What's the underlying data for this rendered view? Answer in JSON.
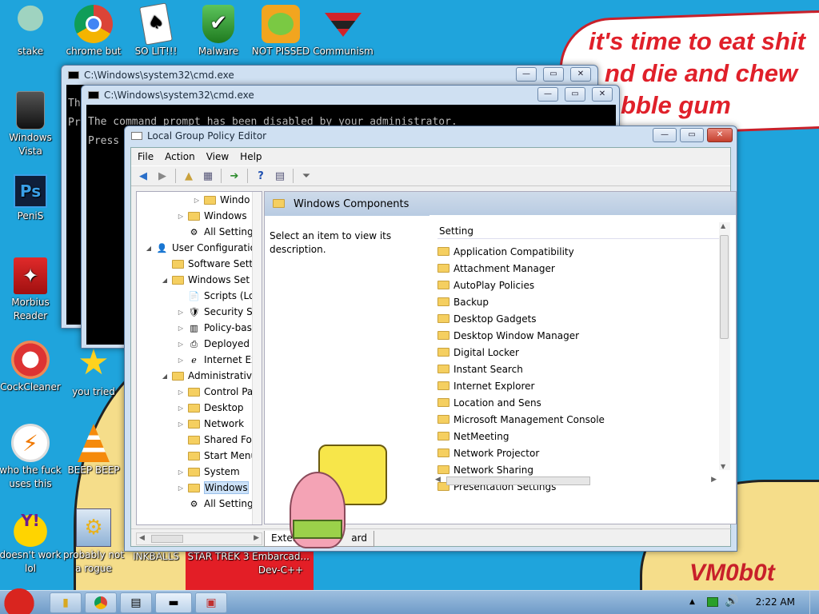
{
  "wallpaper": {
    "speech_lines": [
      "it's time to eat shit",
      "nd die and chew",
      "bble gum"
    ],
    "signature": "VM0b0t"
  },
  "desktop_icons": [
    {
      "label": "stake",
      "icon": "squidward-icon"
    },
    {
      "label": "chrome but",
      "icon": "chrome-icon"
    },
    {
      "label": "SO LIT!!!",
      "icon": "card-icon"
    },
    {
      "label": "Malware",
      "icon": "shield-check-icon"
    },
    {
      "label": "NOT PISSED",
      "icon": "angry-birds-pig-icon"
    },
    {
      "label": "Communism",
      "icon": "emblem-icon"
    },
    {
      "label": "Windows Vista",
      "icon": "recycle-bin-icon"
    },
    {
      "label": "PeniS",
      "icon": "photoshop-icon"
    },
    {
      "label": "Morbius Reader",
      "icon": "acrobat-icon"
    },
    {
      "label": "CockCleaner",
      "icon": "ccleaner-icon"
    },
    {
      "label": "you tried",
      "icon": "star-icon"
    },
    {
      "label": "who the fuck uses this",
      "icon": "winamp-icon"
    },
    {
      "label": "BEEP BEEP",
      "icon": "vlc-cone-icon"
    },
    {
      "label": "doesn't work lol",
      "icon": "yahoo-messenger-icon"
    },
    {
      "label": "probably not a rogue",
      "icon": "gears-icon"
    },
    {
      "label": "INKBALLS",
      "icon": ""
    },
    {
      "label": "STAR TREK 3",
      "icon": ""
    },
    {
      "label": "Embarcad... Dev-C++",
      "icon": ""
    }
  ],
  "cmd_back": {
    "title": "C:\\Windows\\system32\\cmd.exe",
    "lines": [
      "Th",
      "Pr"
    ]
  },
  "cmd_front": {
    "title": "C:\\Windows\\system32\\cmd.exe",
    "lines": [
      "The command prompt has been disabled by your administrator.",
      "Press"
    ]
  },
  "gpedit": {
    "title": "Local Group Policy Editor",
    "menu": [
      "File",
      "Action",
      "View",
      "Help"
    ],
    "tree": [
      {
        "label": "Windo",
        "indent": 3,
        "arrow": "▷",
        "icon": "folder"
      },
      {
        "label": "Windows",
        "indent": 2,
        "arrow": "▷",
        "icon": "folder"
      },
      {
        "label": "All Setting",
        "indent": 2,
        "arrow": "",
        "icon": "settings"
      },
      {
        "label": "User Configuratio",
        "indent": 0,
        "arrow": "◢",
        "icon": "user"
      },
      {
        "label": "Software Sett",
        "indent": 1,
        "arrow": "",
        "icon": "folder"
      },
      {
        "label": "Windows Set",
        "indent": 1,
        "arrow": "◢",
        "icon": "folder"
      },
      {
        "label": "Scripts (Lo",
        "indent": 2,
        "arrow": "",
        "icon": "script"
      },
      {
        "label": "Security S",
        "indent": 2,
        "arrow": "▷",
        "icon": "security"
      },
      {
        "label": "Policy-bas",
        "indent": 2,
        "arrow": "▷",
        "icon": "chart"
      },
      {
        "label": "Deployed",
        "indent": 2,
        "arrow": "▷",
        "icon": "printer"
      },
      {
        "label": "Internet Ex",
        "indent": 2,
        "arrow": "▷",
        "icon": "ie"
      },
      {
        "label": "Administrative",
        "indent": 1,
        "arrow": "◢",
        "icon": "folder"
      },
      {
        "label": "Control Pa",
        "indent": 2,
        "arrow": "▷",
        "icon": "folder"
      },
      {
        "label": "Desktop",
        "indent": 2,
        "arrow": "▷",
        "icon": "folder"
      },
      {
        "label": "Network",
        "indent": 2,
        "arrow": "▷",
        "icon": "folder"
      },
      {
        "label": "Shared Fo",
        "indent": 2,
        "arrow": "",
        "icon": "folder"
      },
      {
        "label": "Start Menu",
        "indent": 2,
        "arrow": "",
        "icon": "folder"
      },
      {
        "label": "System",
        "indent": 2,
        "arrow": "▷",
        "icon": "folder"
      },
      {
        "label": "Windows",
        "indent": 2,
        "arrow": "▷",
        "icon": "folder",
        "selected": true
      },
      {
        "label": "All Setting",
        "indent": 2,
        "arrow": "",
        "icon": "settings"
      }
    ],
    "right_header": "Windows Components",
    "description": "Select an item to view its description.",
    "column_header": "Setting",
    "items": [
      "Application Compatibility",
      "Attachment Manager",
      "AutoPlay Policies",
      "Backup",
      "Desktop Gadgets",
      "Desktop Window Manager",
      "Digital Locker",
      "Instant Search",
      "Internet Explorer",
      "Location and Senso",
      "Microsoft Management Console",
      "NetMeeting",
      "Network Projector",
      "Network Sharing",
      "Presentation Settings"
    ],
    "tabs": [
      "Exten",
      "ard"
    ]
  },
  "taskbar": {
    "time": "2:22 AM"
  }
}
